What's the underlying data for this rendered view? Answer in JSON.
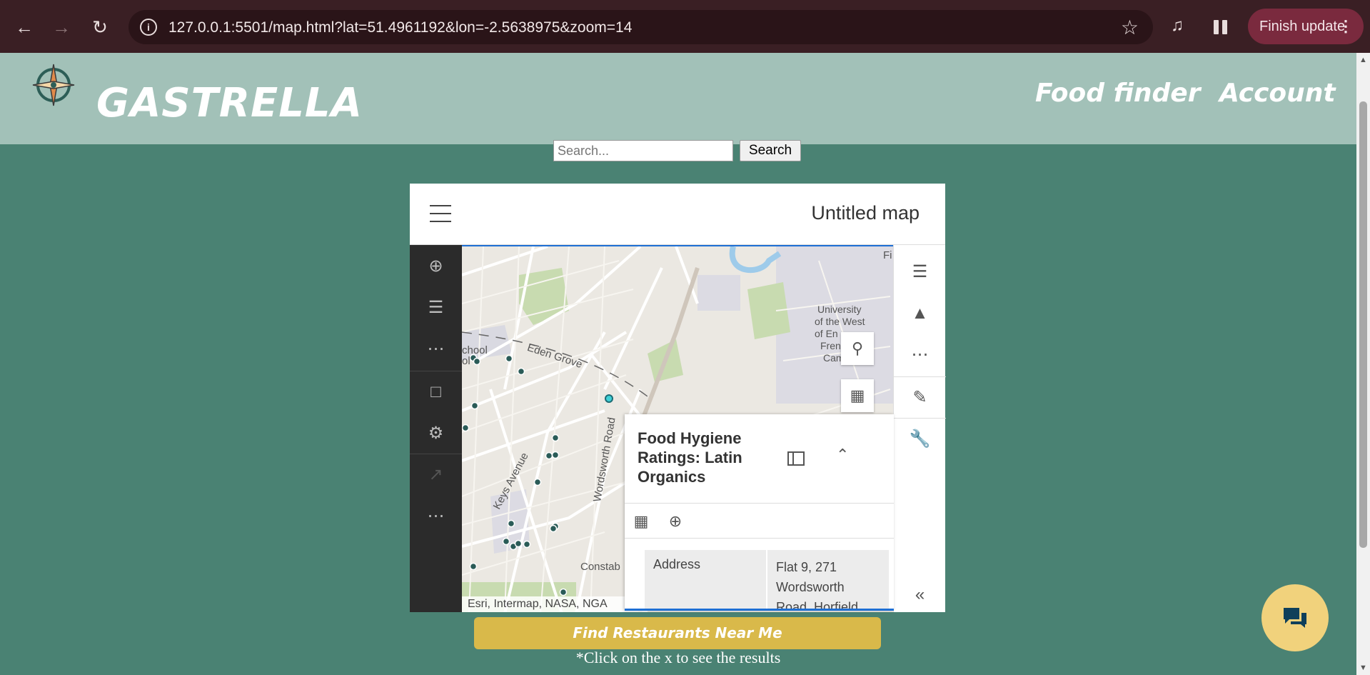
{
  "browser": {
    "url": "127.0.0.1:5501/map.html?lat=51.4961192&lon=-2.5638975&zoom=14",
    "finish_update_label": "Finish update",
    "icons": [
      "back-arrow-icon",
      "forward-arrow-icon",
      "reload-icon",
      "info-icon",
      "star-icon",
      "media-control-icon",
      "pause-icon",
      "kebab-icon"
    ]
  },
  "site": {
    "brand": "GASTRELLA",
    "nav": {
      "food_finder": "Food finder",
      "account": "Account"
    },
    "search": {
      "placeholder": "Search...",
      "button_label": "Search"
    },
    "find_button_label": "Find Restaurants Near Me",
    "hint": "*Click on the x to see the results"
  },
  "map": {
    "title": "Untitled map",
    "labels": {
      "school": "chool",
      "school2": "ol",
      "eden_grove": "Eden Grove",
      "keys_avenue": "Keys Avenue",
      "wordsworth_road": "Wordsworth Road",
      "constable": "Constab",
      "university": "University",
      "of_the_west": "of the West",
      "of_en": "of En",
      "fren": "Fren",
      "cam": "Cam",
      "fi": "Fi"
    },
    "attribution": "Esri, Intermap, NASA, NGA",
    "popup": {
      "title": "Food Hygiene Ratings: Latin Organics",
      "field_label": "Address",
      "field_value": "Flat 9, 271 Wordsworth Road, Horfield,"
    },
    "left_rail_icons": [
      "add-icon",
      "layers-icon",
      "more-icon",
      "folder-icon",
      "settings-icon",
      "share-icon",
      "more-icon"
    ],
    "right_rail_icons": [
      "properties-icon",
      "styles-icon",
      "more-icon",
      "sketch-icon",
      "tools-icon",
      "collapse-icon"
    ],
    "colors": {
      "point_fill": "#2a5b57",
      "selected_point": "#3fd0d6",
      "accent_blue": "#1e6fd4"
    }
  },
  "colors": {
    "page_bg": "#4a8273",
    "header_bg": "#a2c1b8",
    "find_button": "#d9b94a",
    "chat_button": "#f1d27c"
  }
}
